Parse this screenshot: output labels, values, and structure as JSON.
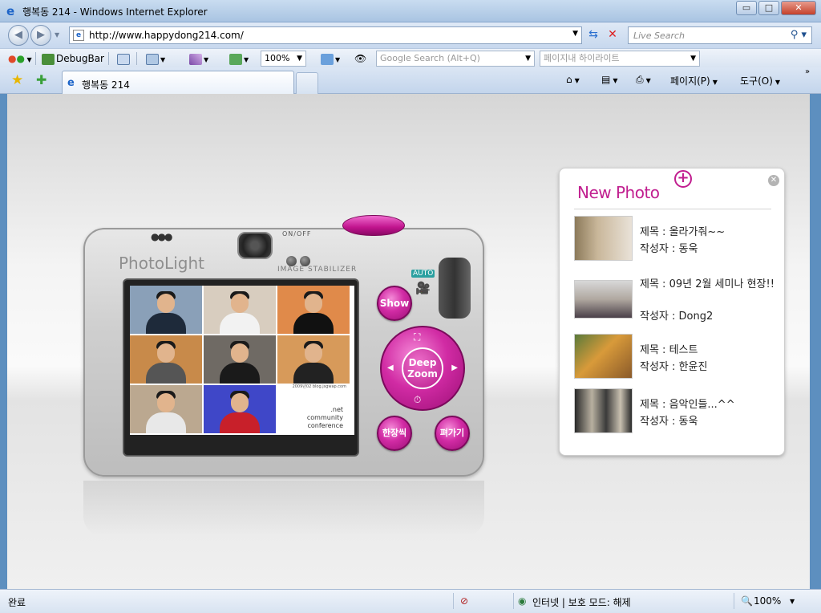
{
  "window": {
    "title": "행복동 214 - Windows Internet Explorer",
    "min_label": "▭",
    "max_label": "□",
    "close_label": "✕"
  },
  "addressbar": {
    "back_label": "◀",
    "forward_label": "▶",
    "url": "http://www.happydong214.com/",
    "search_placeholder": "Live Search"
  },
  "toolbar": {
    "debugbar_label": "DebugBar",
    "zoom_value": "100%",
    "google_placeholder": "Google Search (Alt+Q)",
    "highlight_placeholder": "페이지내 하이라이트"
  },
  "tabs": {
    "active_label": "행복동 214",
    "page_menu": "페이지(P)",
    "tools_menu": "도구(O)"
  },
  "camera": {
    "brand": "PhotoLight",
    "onoff": "ON/OFF",
    "stabilizer": "IMAGE STABILIZER",
    "auto": "AUTO",
    "show_button": "Show",
    "deep_zoom_line1": "Deep",
    "deep_zoom_line2": "Zoom",
    "one_by_one_button": "한장씩",
    "spread_button": "펴가기",
    "screen_watermark": "2009년02 blog.jsgwap.com",
    "screen_caption_line1": ".net",
    "screen_caption_line2": "community",
    "screen_caption_line3": "conference"
  },
  "new_photo": {
    "title": "New Photo",
    "items": [
      {
        "title": "제목 : 올라가줘~~",
        "author": "작성자 : 동욱"
      },
      {
        "title": "제목 : 09년 2월 세미나 현장!!",
        "author": "작성자 : Dong2"
      },
      {
        "title": "제목 : 테스트",
        "author": "작성자 : 한윤진"
      },
      {
        "title": "제목 : 음악인들...^^",
        "author": "작성자 : 동욱"
      }
    ]
  },
  "status": {
    "left": "완료",
    "zone": "인터넷 | 보호 모드: 해제",
    "zoom": "100%"
  },
  "colors": {
    "accent_pink": "#c11e8f",
    "ie_blue": "#1d64c8"
  }
}
